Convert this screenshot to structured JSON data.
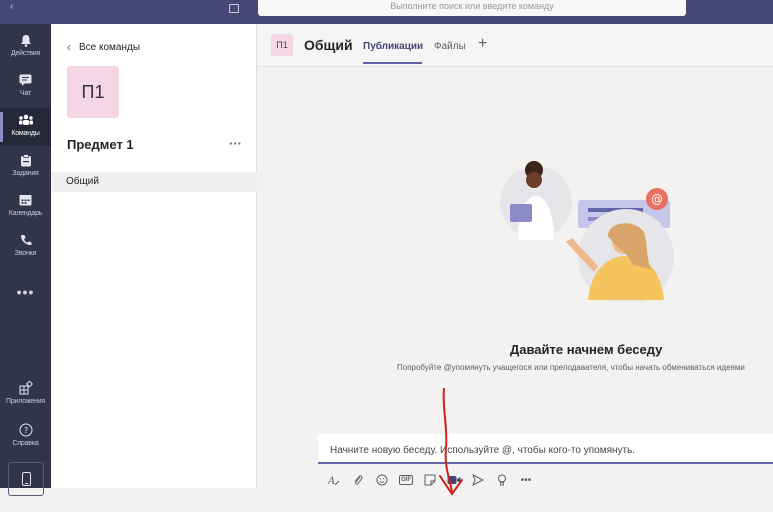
{
  "topbar": {
    "search_placeholder": "Выполните поиск или введите команду"
  },
  "rail": {
    "items": [
      {
        "label": "Действия",
        "icon": "bell-icon"
      },
      {
        "label": "Чат",
        "icon": "chat-icon"
      },
      {
        "label": "Команды",
        "icon": "teams-icon"
      },
      {
        "label": "Задания",
        "icon": "assignments-icon"
      },
      {
        "label": "Календарь",
        "icon": "calendar-icon"
      },
      {
        "label": "Звонки",
        "icon": "phone-icon"
      }
    ],
    "more": "•••",
    "apps_label": "Приложения",
    "help_label": "Справка",
    "active_index": 2
  },
  "team_panel": {
    "back_label": "Все команды",
    "avatar_text": "П1",
    "team_name": "Предмет 1",
    "more": "···",
    "channel": "Общий"
  },
  "header": {
    "avatar_text": "П1",
    "channel_name": "Общий",
    "tabs": [
      {
        "label": "Публикации",
        "active": true
      },
      {
        "label": "Файлы",
        "active": false
      }
    ],
    "add_tab": "+"
  },
  "empty_state": {
    "title": "Давайте начнем беседу",
    "subtitle": "Попробуйте @упомянуть учащегося или преподавателя, чтобы начать обмениваться идеями"
  },
  "compose": {
    "placeholder": "Начните новую беседу. Используйте @, чтобы кого-то упомянуть.",
    "toolbar": [
      {
        "icon": "format-icon"
      },
      {
        "icon": "attach-icon"
      },
      {
        "icon": "emoji-icon"
      },
      {
        "icon": "gif-icon",
        "label": "GIF"
      },
      {
        "icon": "sticker-icon"
      },
      {
        "icon": "meet-now-icon"
      },
      {
        "icon": "send-praise-icon"
      },
      {
        "icon": "bulb-icon"
      },
      {
        "icon": "more-icon",
        "label": "•••"
      }
    ]
  },
  "colors": {
    "rail": "#33344a",
    "topbar": "#464775",
    "accent": "#6264a7",
    "team_avatar": "#f4d6e5",
    "annotation": "#d0211c"
  }
}
